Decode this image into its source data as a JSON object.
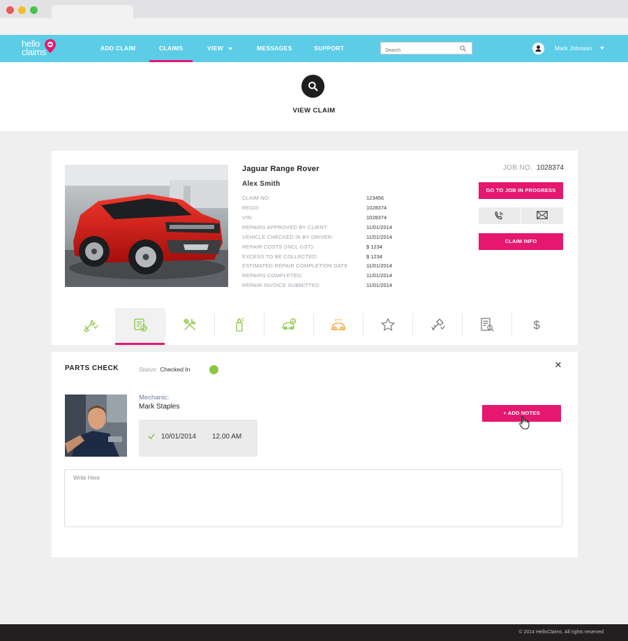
{
  "browser": {
    "tab_title": ""
  },
  "brand": {
    "line1": "hello",
    "line2": "claims",
    "accent": "#e5176f",
    "nav_bg": "#5dcde7"
  },
  "nav": {
    "items": [
      {
        "label": "ADD CLAIM",
        "active": false
      },
      {
        "label": "CLAIMS",
        "active": true
      },
      {
        "label": "VIEW",
        "active": false,
        "dropdown": true
      },
      {
        "label": "MESSAGES",
        "active": false
      },
      {
        "label": "SUPPORT",
        "active": false
      }
    ]
  },
  "search": {
    "placeholder": "Search",
    "icon": "search-icon"
  },
  "user": {
    "name": "Mark Johnson",
    "icon": "user-icon"
  },
  "page": {
    "title": "VIEW CLAIM",
    "icon": "search-icon"
  },
  "claim": {
    "vehicle": "Jaguar Range Rover",
    "owner": "Alex Smith",
    "job_label": "JOB NO.",
    "job_number": "1028374",
    "details": [
      {
        "label": "CLAIM NO:",
        "value": "123456"
      },
      {
        "label": "REGO:",
        "value": "1028374"
      },
      {
        "label": "VIN:",
        "value": "1028374"
      },
      {
        "label": "REPAIRS APPROVED BY CLIENT:",
        "value": "11/01/2014"
      },
      {
        "label": "VEHICLE CHECKED IN BY DRIVER:",
        "value": "11/01/2014"
      },
      {
        "label": "REPAIR COSTS (INCL GST):",
        "value": "$ 1234"
      },
      {
        "label": "EXCESS TO BE COLLECTED:",
        "value": "$ 1234"
      },
      {
        "label": "ESTIMATED REPAIR COMPLETION DATE:",
        "value": "11/01/2014"
      },
      {
        "label": "REPAIRS COMPLETED:",
        "value": "11/01/2014"
      },
      {
        "label": "REPAIR INVOICE SUBMITTED:",
        "value": "11/01/2014"
      }
    ],
    "btn_job": "GO TO JOB IN PROGRESS",
    "btn_info": "CLAIM INFO",
    "contact_icons": [
      "phone-icon",
      "mail-icon"
    ]
  },
  "stage_tabs": [
    {
      "icon": "wrench-check-icon",
      "color": "#8cc640",
      "active": false
    },
    {
      "icon": "parts-check-icon",
      "color": "#8cc640",
      "active": true
    },
    {
      "icon": "tools-icon",
      "color": "#8cc640",
      "active": false
    },
    {
      "icon": "spray-paint-icon",
      "color": "#8cc640",
      "active": false
    },
    {
      "icon": "car-check-icon",
      "color": "#8cc640",
      "active": false
    },
    {
      "icon": "car-wash-icon",
      "color": "#f39a2b",
      "active": false
    },
    {
      "icon": "star-icon",
      "color": "#777777",
      "active": false
    },
    {
      "icon": "key-icon",
      "color": "#777777",
      "active": false
    },
    {
      "icon": "invoice-search-icon",
      "color": "#777777",
      "active": false
    },
    {
      "icon": "dollar-icon",
      "color": "#777777",
      "active": false
    }
  ],
  "parts": {
    "title": "PARTS CHECK",
    "status_label": "Status:",
    "status_value": "Checked In",
    "status_color": "#8cc640",
    "mechanic_label": "Mechanic:",
    "mechanic_name": "Mark Staples",
    "date": "10/01/2014",
    "time": "12.00 AM",
    "btn_notes": "+ ADD NOTES",
    "notes_placeholder": "Write Here"
  },
  "footer": {
    "copyright": "© 2014 HelloClaims. All rights reserved"
  }
}
